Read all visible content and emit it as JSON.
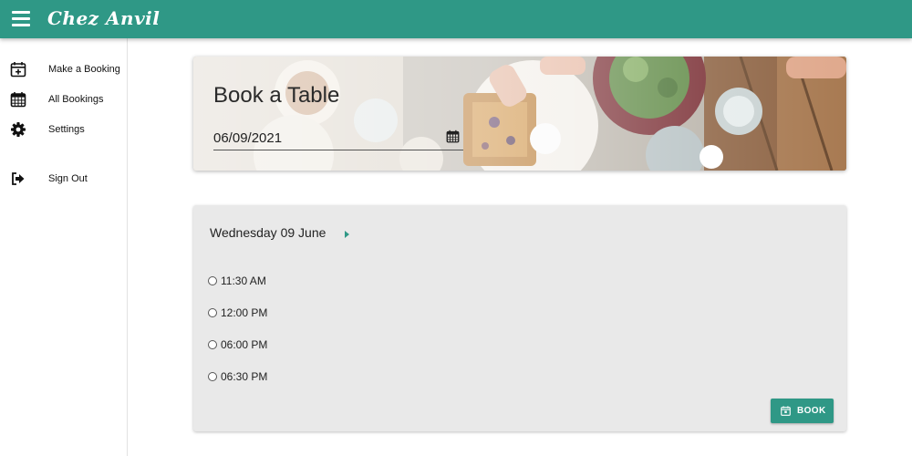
{
  "app": {
    "brand": "Chez Anvil"
  },
  "sidebar": {
    "items": [
      {
        "label": "Make a Booking",
        "icon": "calendar-plus-icon"
      },
      {
        "label": "All Bookings",
        "icon": "calendar-grid-icon"
      },
      {
        "label": "Settings",
        "icon": "gear-icon"
      },
      {
        "label": "Sign Out",
        "icon": "sign-out-icon"
      }
    ]
  },
  "hero": {
    "title": "Book a Table",
    "date_value": "06/09/2021"
  },
  "schedule": {
    "day_label": "Wednesday 09 June",
    "slots": [
      {
        "label": "11:30 AM",
        "selected": false
      },
      {
        "label": "12:00 PM",
        "selected": false
      },
      {
        "label": "06:00 PM",
        "selected": false
      },
      {
        "label": "06:30 PM",
        "selected": false
      }
    ],
    "book_label": "BOOK"
  },
  "colors": {
    "accent": "#2f9886",
    "card_background": "#e9e9e9"
  }
}
